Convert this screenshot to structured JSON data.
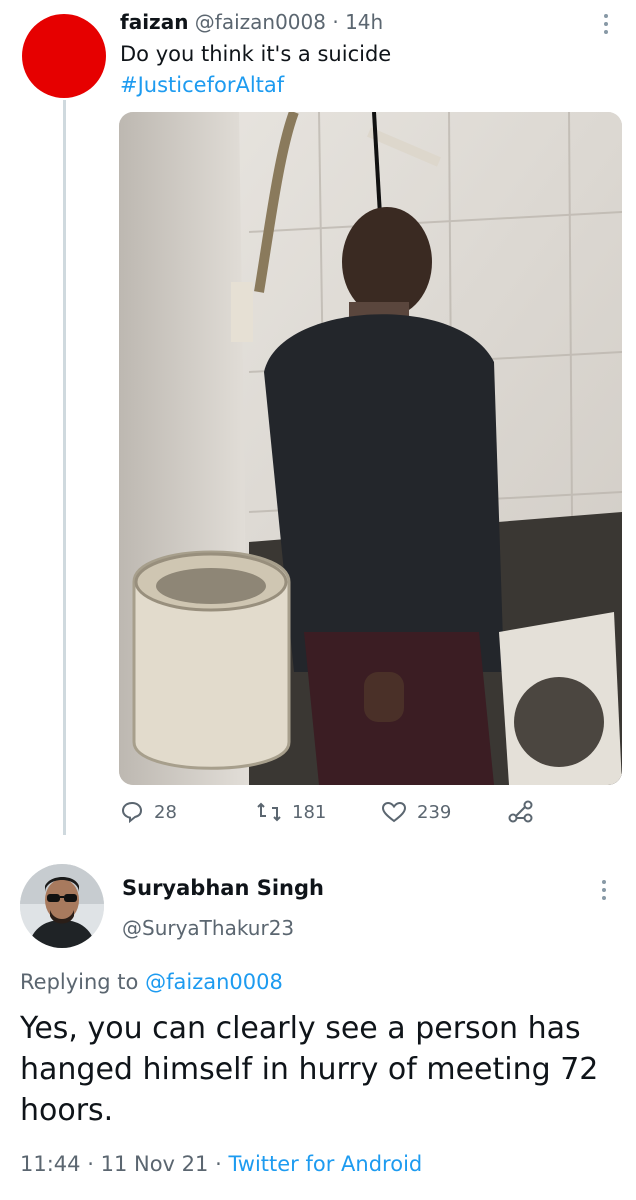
{
  "tweet": {
    "author_name": "faizan",
    "author_handle": "@faizan0008",
    "separator": "·",
    "age": "14h",
    "text": "Do you think it's a suicide",
    "hashtag": "#JusticeforAltaf",
    "actions": {
      "replies": "28",
      "retweets": "181",
      "likes": "239"
    }
  },
  "reply": {
    "author_name": "Suryabhan Singh",
    "author_handle": "@SuryaThakur23",
    "replying_prefix": "Replying to",
    "replying_handle": "@faizan0008",
    "text": "Yes, you can clearly see a person has hanged himself in hurry of meeting 72 hoors.",
    "time": "11:44",
    "sep1": "·",
    "date": "11 Nov 21",
    "sep2": "·",
    "source": "Twitter for Android"
  },
  "colors": {
    "accent": "#1d9bf0",
    "secondary_text": "#5b6670",
    "avatar_red": "#e60000"
  },
  "icons": [
    "reply-icon",
    "retweet-icon",
    "like-icon",
    "share-icon",
    "more-icon"
  ]
}
